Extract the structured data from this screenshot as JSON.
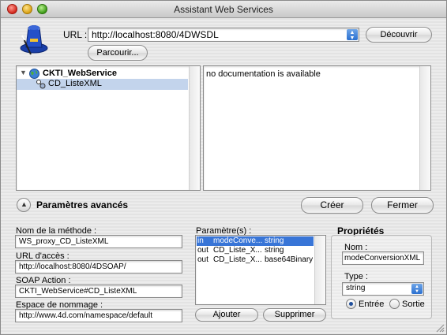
{
  "window": {
    "title": "Assistant Web Services"
  },
  "url_row": {
    "label": "URL :",
    "value": "http://localhost:8080/4DWSDL",
    "discover_label": "Découvrir",
    "browse_label": "Parcourir..."
  },
  "tree": {
    "root": "CKTI_WebService",
    "child": "CD_ListeXML"
  },
  "documentation": "no documentation is available",
  "advanced": {
    "label": "Paramètres avancés"
  },
  "actions": {
    "create_label": "Créer",
    "close_label": "Fermer"
  },
  "method": {
    "name_label": "Nom de la méthode :",
    "name_value": "WS_proxy_CD_ListeXML",
    "url_label": "URL d'accès :",
    "url_value": "http://localhost:8080/4DSOAP/",
    "soap_label": "SOAP Action :",
    "soap_value": "CKTI_WebService#CD_ListeXML",
    "ns_label": "Espace de nommage :",
    "ns_value": "http://www.4d.com/namespace/default"
  },
  "parameters": {
    "label": "Paramètre(s) :",
    "rows": [
      {
        "dir": "in",
        "name": "modeConve...",
        "type": "string"
      },
      {
        "dir": "out",
        "name": "CD_Liste_X...",
        "type": "string"
      },
      {
        "dir": "out",
        "name": "CD_Liste_X...",
        "type": "base64Binary"
      }
    ],
    "add_label": "Ajouter",
    "remove_label": "Supprimer"
  },
  "properties": {
    "title": "Propriétés",
    "name_label": "Nom :",
    "name_value": "modeConversionXML",
    "type_label": "Type :",
    "type_value": "string",
    "input_label": "Entrée",
    "output_label": "Sortie"
  }
}
